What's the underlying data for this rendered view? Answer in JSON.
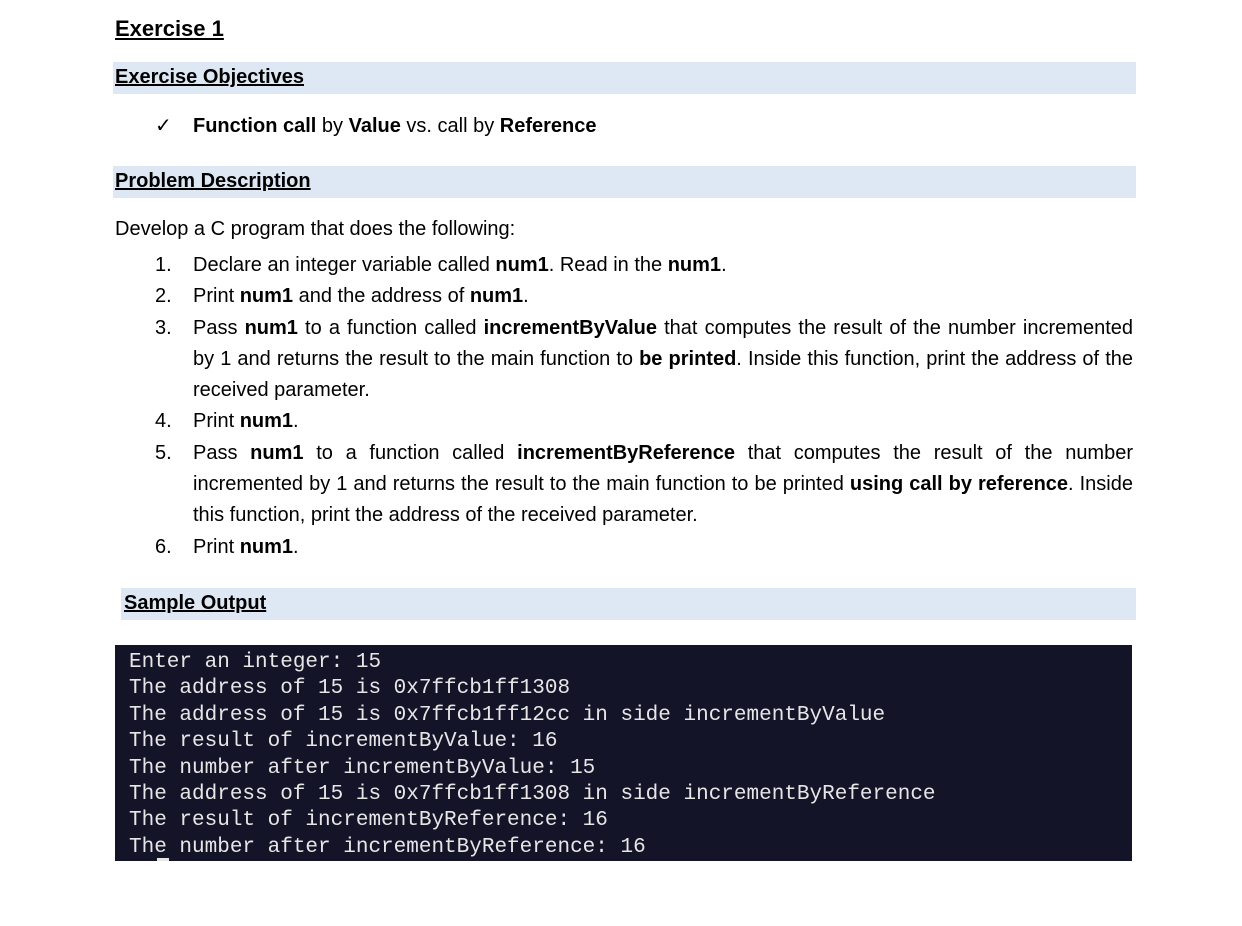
{
  "title": "Exercise 1",
  "sections": {
    "objectives_heading": "Exercise Objectives",
    "problem_heading": "Problem Description",
    "sample_heading": "Sample Output"
  },
  "objective": {
    "check": "✓",
    "bold1": "Function call",
    "t1": " by ",
    "bold2": "Value",
    "t2": " vs. call by ",
    "bold3": "Reference"
  },
  "intro": "Develop a C program that does the following:",
  "steps": [
    {
      "num": "1.",
      "parts": [
        {
          "t": "Declare an integer variable called "
        },
        {
          "b": "num1"
        },
        {
          "t": ". Read in the "
        },
        {
          "b": "num1"
        },
        {
          "t": "."
        }
      ]
    },
    {
      "num": "2.",
      "parts": [
        {
          "t": "Print "
        },
        {
          "b": "num1"
        },
        {
          "t": " and the address of "
        },
        {
          "b": "num1"
        },
        {
          "t": "."
        }
      ]
    },
    {
      "num": "3.",
      "parts": [
        {
          "t": "Pass "
        },
        {
          "b": "num1"
        },
        {
          "t": " to a function called "
        },
        {
          "b": "incrementByValue"
        },
        {
          "t": " that computes the result of the number incremented by 1 and returns the result to the main function to "
        },
        {
          "b": "be printed"
        },
        {
          "t": ". Inside this function, print the address of the received parameter."
        }
      ]
    },
    {
      "num": "4.",
      "parts": [
        {
          "t": "Print "
        },
        {
          "b": "num1"
        },
        {
          "t": "."
        }
      ]
    },
    {
      "num": "5.",
      "parts": [
        {
          "t": "Pass "
        },
        {
          "b": "num1"
        },
        {
          "t": " to a function called "
        },
        {
          "b": "incrementByReference"
        },
        {
          "t": " that computes the result of the number incremented by 1 and returns the result to the main function to be printed "
        },
        {
          "b": "using call by reference"
        },
        {
          "t": ". Inside this function, print the address of the received parameter."
        }
      ]
    },
    {
      "num": "6.",
      "parts": [
        {
          "t": "Print "
        },
        {
          "b": "num1"
        },
        {
          "t": "."
        }
      ]
    }
  ],
  "console_lines": [
    "Enter an integer: 15",
    "The address of 15 is 0x7ffcb1ff1308",
    "The address of 15 is 0x7ffcb1ff12cc in side incrementByValue",
    "The result of incrementByValue: 16",
    "The number after incrementByValue: 15",
    "The address of 15 is 0x7ffcb1ff1308 in side incrementByReference",
    "The result of incrementByReference: 16",
    "The number after incrementByReference: 16"
  ]
}
